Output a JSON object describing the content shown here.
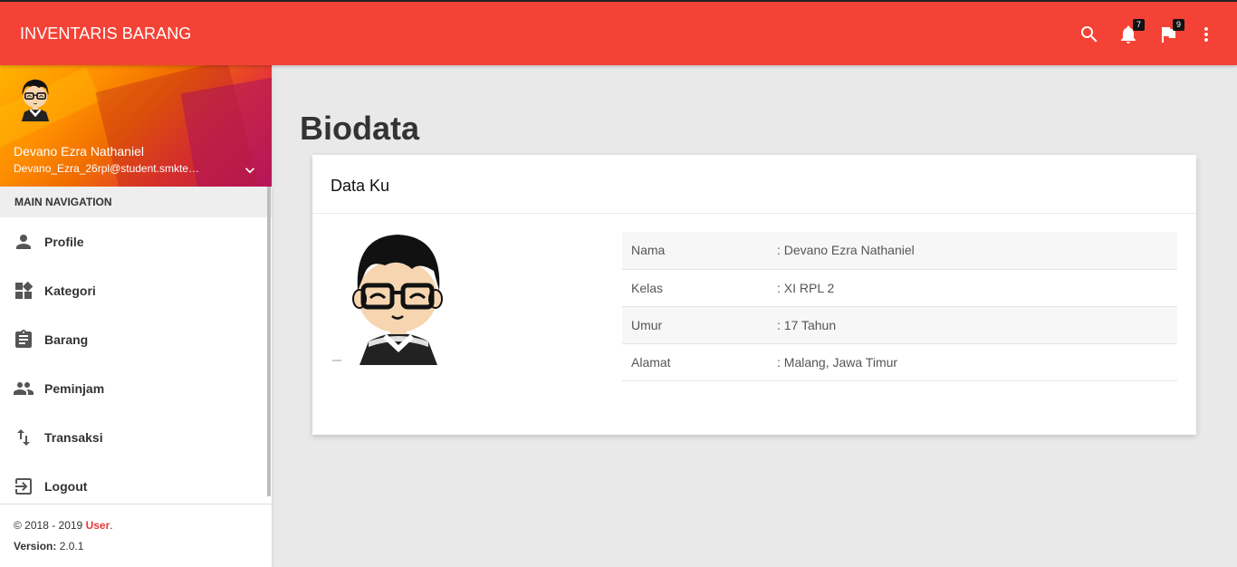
{
  "app": {
    "title": "INVENTARIS BARANG"
  },
  "topbar": {
    "icons": [
      {
        "name": "search-icon"
      },
      {
        "name": "bell-icon",
        "badge": "7"
      },
      {
        "name": "flag-icon",
        "badge": "9"
      },
      {
        "name": "more-vert-icon"
      }
    ]
  },
  "user": {
    "name": "Devano Ezra Nathaniel",
    "email": "Devano_Ezra_26rpl@student.smktel..."
  },
  "sidebar": {
    "header": "MAIN NAVIGATION",
    "items": [
      {
        "label": "Profile",
        "icon": "person-icon"
      },
      {
        "label": "Kategori",
        "icon": "widgets-icon"
      },
      {
        "label": "Barang",
        "icon": "assignment-icon"
      },
      {
        "label": "Peminjam",
        "icon": "people-icon"
      },
      {
        "label": "Transaksi",
        "icon": "swap-vert-icon"
      },
      {
        "label": "Logout",
        "icon": "logout-icon"
      }
    ]
  },
  "footer": {
    "copyright_prefix": "© 2018 - 2019 ",
    "copyright_link": "User",
    "copyright_suffix": ".",
    "version_label": "Version:",
    "version_value": " 2.0.1"
  },
  "main": {
    "title": "Biodata",
    "card_title": "Data Ku",
    "biodata": [
      {
        "label": "Nama",
        "value": ": Devano Ezra Nathaniel"
      },
      {
        "label": "Kelas",
        "value": ": XI RPL 2"
      },
      {
        "label": "Umur",
        "value": ": 17 Tahun"
      },
      {
        "label": "Alamat",
        "value": ": Malang, Jawa Timur"
      }
    ]
  },
  "colors": {
    "primary": "#f44336",
    "accent_text": "#e53935",
    "background": "#e9e9e9"
  }
}
